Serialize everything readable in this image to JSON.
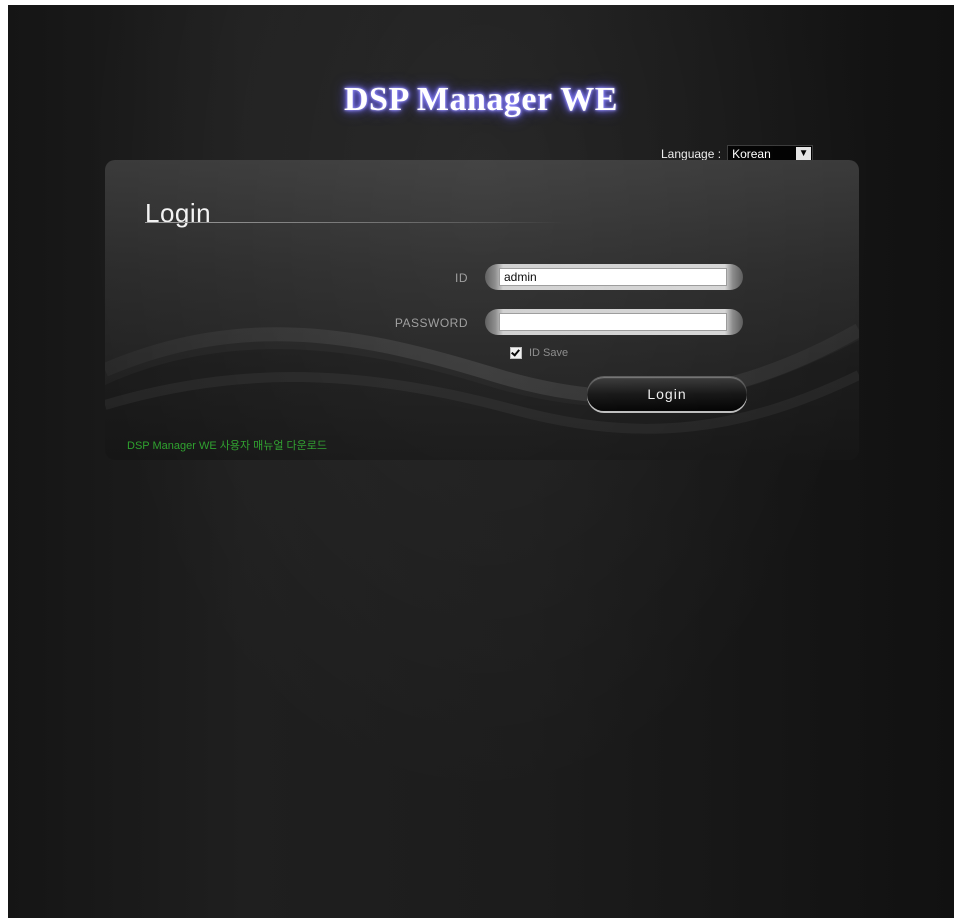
{
  "app": {
    "title": "DSP Manager WE"
  },
  "language": {
    "label": "Language :",
    "selected": "Korean"
  },
  "login": {
    "heading": "Login",
    "id_label": "ID",
    "id_value": "admin",
    "password_label": "PASSWORD",
    "password_value": "",
    "id_save_label": "ID Save",
    "id_save_checked": true,
    "submit_label": "Login"
  },
  "footer": {
    "manual_link": "DSP Manager WE 사용자 매뉴얼 다운로드"
  },
  "colors": {
    "title_glow": "#8f88ff",
    "manual_link": "#2ea12e",
    "background": "#1c1c1c"
  },
  "icons": {
    "language_dropdown": "chevron-down-icon",
    "id_save": "checkbox-checked-icon"
  }
}
